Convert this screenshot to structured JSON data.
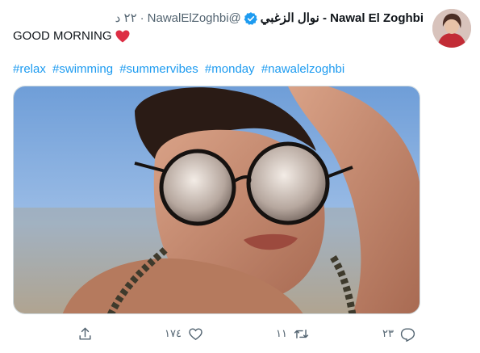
{
  "tweet": {
    "author_name": "Nawal El Zoghbi - نوال الزغبي",
    "handle": "@NawalElZoghbi",
    "separator": "·",
    "time": "٢٢ د",
    "text": "GOOD MORNING",
    "hashtags": [
      "#relax",
      "#swimming",
      "#summervibes",
      "#monday",
      "#nawalelzoghbi"
    ]
  },
  "actions": {
    "reply_count": "٢٣",
    "retweet_count": "١١",
    "like_count": "١٧٤"
  },
  "icons": {
    "verified": "verified-badge-icon",
    "emoji": "red-heart-emoji",
    "reply": "reply-icon",
    "retweet": "retweet-icon",
    "like": "heart-icon",
    "share": "share-icon"
  },
  "colors": {
    "accent": "#1d9bf0",
    "text": "#0f1419",
    "muted": "#536471",
    "heart": "#dd2e44"
  }
}
